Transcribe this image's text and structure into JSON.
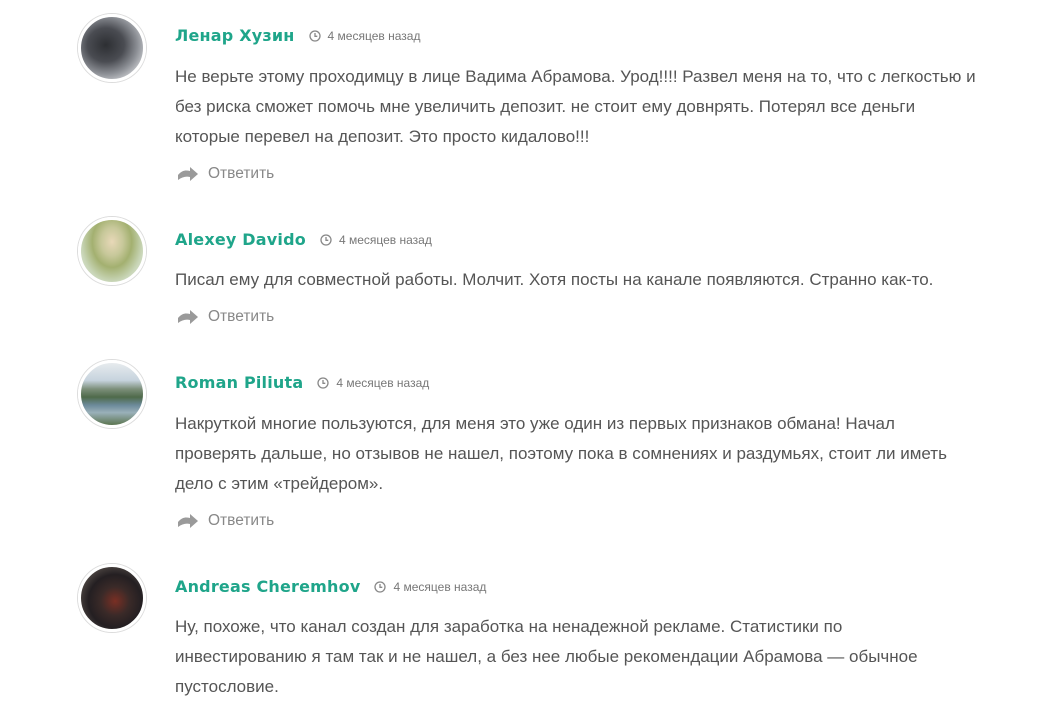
{
  "comments": [
    {
      "author": "Ленар Хузин",
      "time": "4 месяцев назад",
      "lines": [
        "Не верьте этому проходимцу в лице Вадима Абрамова. Урод!!!! Развел меня на то, что с легкостью и",
        "без риска сможет помочь мне увеличить депозит. не стоит ему довнрять. Потерял все деньги",
        "которые перевел на депозит. Это просто кидалово!!!"
      ],
      "reply_label": "Ответить"
    },
    {
      "author": "Alexey Davido",
      "time": "4 месяцев назад",
      "lines": [
        "Писал ему для совместной работы. Молчит. Хотя посты на канале появляются. Странно как-то."
      ],
      "reply_label": "Ответить"
    },
    {
      "author": "Roman Piliuta",
      "time": "4 месяцев назад",
      "lines": [
        "Накруткой многие пользуются, для меня это уже один из первых признаков обмана! Начал",
        "проверять дальше, но отзывов не нашел, поэтому пока в сомнениях и раздумьях, стоит ли иметь",
        "дело с этим «трейдером»."
      ],
      "reply_label": "Ответить"
    },
    {
      "author": "Andreas Cheremhov",
      "time": "4 месяцев назад",
      "lines": [
        "Ну, похоже, что канал создан для заработка на ненадежной рекламе. Статистики по",
        "инвестированию я там так и не нашел, а без нее любые рекомендации Абрамова — обычное",
        "пустословие."
      ]
    }
  ],
  "colors": {
    "author": "#1fa58a",
    "text": "#555555",
    "meta": "#777777",
    "reply": "#888888"
  },
  "icons": {
    "time": "clock-icon",
    "reply": "reply-arrow-icon"
  }
}
